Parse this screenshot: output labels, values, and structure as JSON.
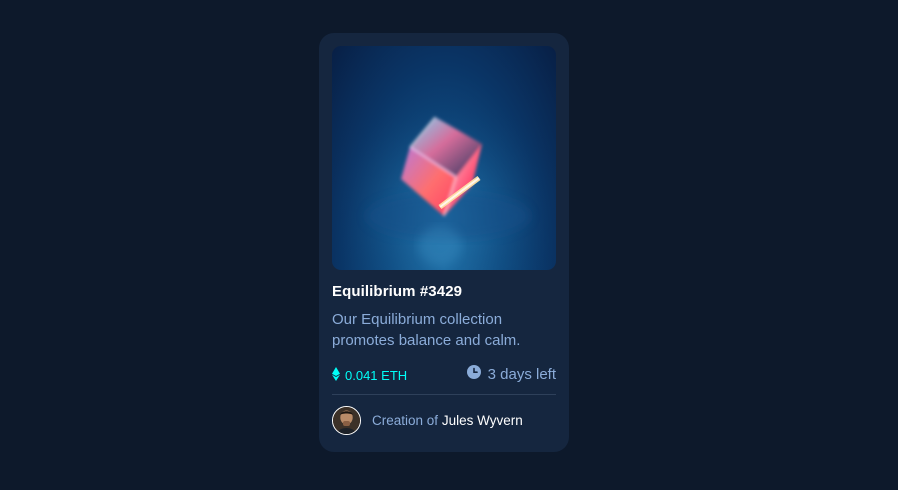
{
  "card": {
    "image_alt": "Equilibrium",
    "title": "Equilibrium #3429",
    "description": "Our Equilibrium collection promotes balance and calm.",
    "price": "0.041 ETH",
    "time_left": "3 days left",
    "creator_prefix": "Creation of",
    "creator_name": "Jules Wyvern"
  },
  "icons": {
    "price": "ethereum-icon",
    "time": "clock-icon",
    "avatar": "avatar-image"
  },
  "colors": {
    "page_background": "#0d192b",
    "card_background": "#15263f",
    "accent_cyan": "#00fff8",
    "soft_blue": "#8bacd9",
    "white": "#ffffff",
    "divider": "#2e405a"
  }
}
